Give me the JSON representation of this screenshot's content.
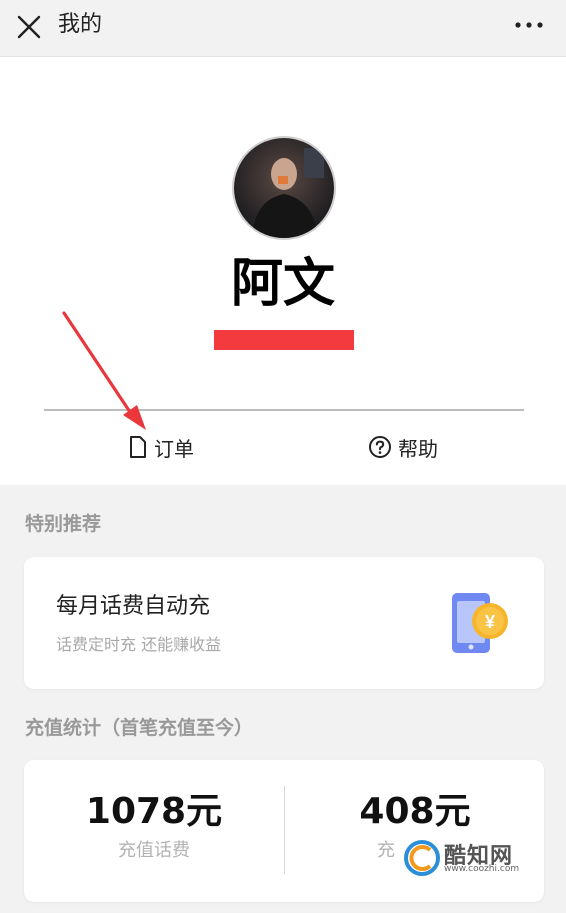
{
  "topbar": {
    "title": "我的"
  },
  "profile": {
    "name": "阿文"
  },
  "actions": {
    "order_label": "订单",
    "help_label": "帮助"
  },
  "recommend": {
    "section_title": "特别推荐",
    "card_title": "每月话费自动充",
    "card_subtitle": "话费定时充 还能赚收益"
  },
  "stats": {
    "section_title": "充值统计（首笔充值至今）",
    "items": [
      {
        "value": "1078元",
        "label": "充值话费"
      },
      {
        "value": "408元",
        "label": "充"
      }
    ]
  },
  "watermark": {
    "text": "酷知网",
    "url": "www.coozhi.com"
  },
  "colors": {
    "red_redaction": "#f23a3f",
    "icon_blue": "#6f88f2",
    "icon_yellow": "#f7b52b",
    "arrow_red": "#e9373b"
  }
}
